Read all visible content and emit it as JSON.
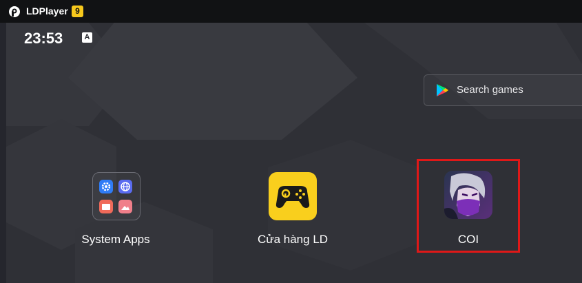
{
  "titlebar": {
    "app_name": "LDPlayer",
    "version_badge": "9"
  },
  "status_bar": {
    "time": "23:53",
    "keyboard_indicator": "A"
  },
  "search": {
    "placeholder": "Search games",
    "icon": "play-store-icon"
  },
  "apps": [
    {
      "label": "System Apps",
      "icon": "folder-icon"
    },
    {
      "label": "Cửa hàng LD",
      "icon": "gamepad-icon"
    },
    {
      "label": "COI",
      "icon": "game-character-icon"
    }
  ],
  "highlight": {
    "target": "COI",
    "color": "#e01818"
  },
  "colors": {
    "titlebar": "#111214",
    "background": "#2f3036",
    "store_yellow": "#f9cf1d",
    "badge_yellow": "#f7c81c"
  }
}
